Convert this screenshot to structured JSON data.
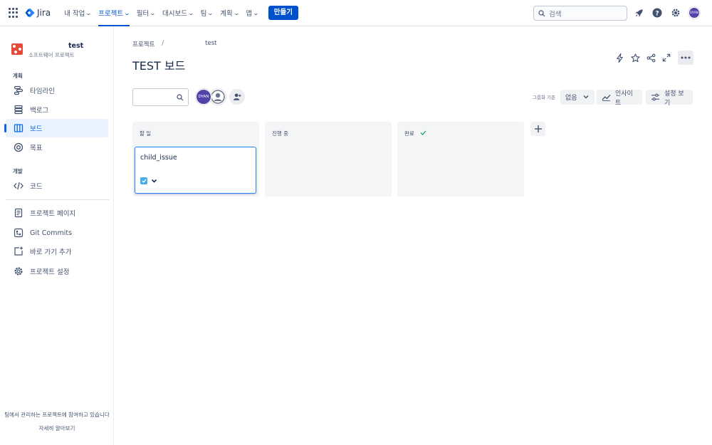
{
  "topnav": {
    "logo_text": "Jira",
    "items": [
      {
        "label": "내 작업"
      },
      {
        "label": "프로젝트"
      },
      {
        "label": "필터"
      },
      {
        "label": "대시보드"
      },
      {
        "label": "팀"
      },
      {
        "label": "계획"
      },
      {
        "label": "앱"
      }
    ],
    "active_item": "프로젝트",
    "create_label": "만들기",
    "search_placeholder": "검색",
    "user_avatar_initials": "DYAN"
  },
  "sidebar": {
    "project_name": "test",
    "project_type": "소프트웨어 프로젝트",
    "section_plan": "계획",
    "plan_items": [
      {
        "label": "타임라인",
        "icon": "timeline-icon"
      },
      {
        "label": "백로그",
        "icon": "backlog-icon"
      },
      {
        "label": "보드",
        "icon": "board-icon"
      },
      {
        "label": "목표",
        "icon": "goals-icon"
      }
    ],
    "active_item": "보드",
    "section_dev": "개발",
    "dev_items": [
      {
        "label": "코드",
        "icon": "code-icon"
      }
    ],
    "other_items": [
      {
        "label": "프로젝트 페이지",
        "icon": "pages-icon"
      },
      {
        "label": "Git Commits",
        "icon": "git-commits-icon"
      },
      {
        "label": "바로 가기 추가",
        "icon": "add-shortcut-icon"
      },
      {
        "label": "프로젝트 설정",
        "icon": "settings-icon"
      }
    ],
    "footer_text": "팀에서 관리하는 프로젝트에 참여하고 있습니다",
    "footer_link": "자세히 알아보기"
  },
  "main": {
    "breadcrumb": [
      "프로젝트",
      "test"
    ],
    "title": "TEST 보드",
    "assignee_avatar_initials": "DYAN",
    "group_by_label": "그룹화 기준",
    "group_by_value": "없음",
    "insights_label": "인사이트",
    "view_settings_label": "설정 보기"
  },
  "board": {
    "columns": [
      {
        "title": "할 일",
        "done": false
      },
      {
        "title": "진행 중",
        "done": false
      },
      {
        "title": "완료",
        "done": true
      }
    ],
    "cards": [
      {
        "title": "child_issue",
        "column": "할 일",
        "type": "task-icon",
        "priority": "chevron-down-icon"
      }
    ]
  },
  "colors": {
    "accent": "#0052cc",
    "card_border": "#2684ff",
    "project_icon": "#e5493a",
    "avatar": "#5243aa",
    "done_check": "#22a06b"
  }
}
